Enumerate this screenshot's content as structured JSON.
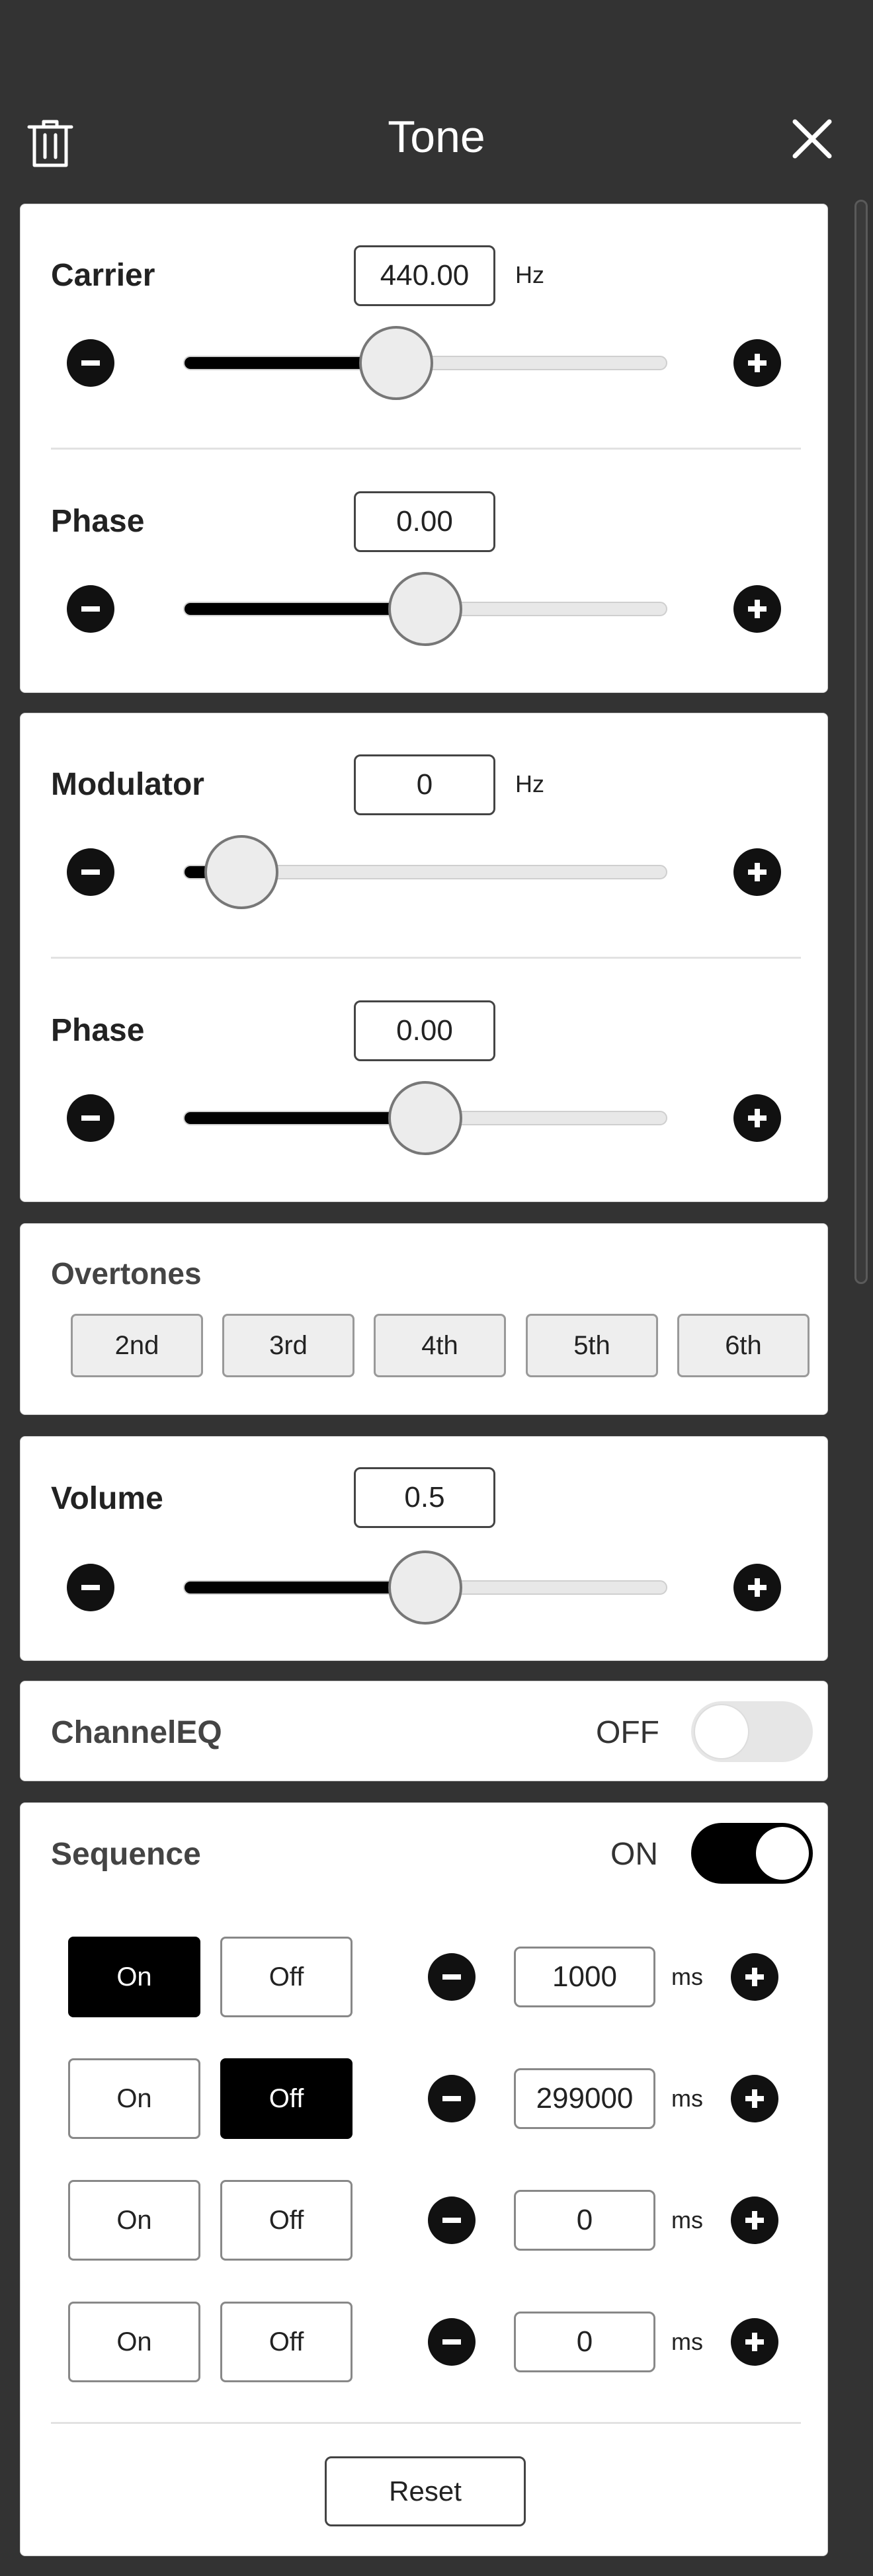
{
  "header": {
    "title": "Tone"
  },
  "carrier": {
    "label": "Carrier",
    "value": "440.00",
    "unit": "Hz",
    "slider_fraction": 0.44,
    "phase": {
      "label": "Phase",
      "value": "0.00",
      "slider_fraction": 0.5
    }
  },
  "modulator": {
    "label": "Modulator",
    "value": "0",
    "unit": "Hz",
    "slider_fraction": 0.12,
    "phase": {
      "label": "Phase",
      "value": "0.00",
      "slider_fraction": 0.5
    }
  },
  "overtones": {
    "label": "Overtones",
    "buttons": [
      "2nd",
      "3rd",
      "4th",
      "5th",
      "6th"
    ]
  },
  "volume": {
    "label": "Volume",
    "value": "0.5",
    "slider_fraction": 0.5
  },
  "channeleq": {
    "label": "ChannelEQ",
    "state": "OFF"
  },
  "sequence": {
    "label": "Sequence",
    "state": "ON",
    "on_label": "On",
    "off_label": "Off",
    "unit": "ms",
    "rows": [
      {
        "active": "on",
        "value": "1000"
      },
      {
        "active": "off",
        "value": "299000"
      },
      {
        "active": "none",
        "value": "0"
      },
      {
        "active": "none",
        "value": "0"
      }
    ],
    "reset_label": "Reset"
  },
  "colors": {
    "background": "#333333",
    "accent": "#000000",
    "toggle_off": "#e6e6e6"
  }
}
